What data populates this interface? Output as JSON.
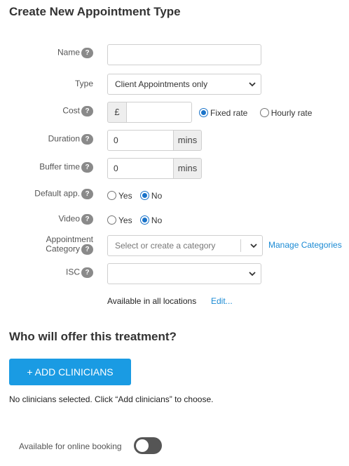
{
  "page_title": "Create New Appointment Type",
  "help_glyph": "?",
  "fields": {
    "name": {
      "label": "Name",
      "value": ""
    },
    "type": {
      "label": "Type",
      "selected": "Client Appointments only"
    },
    "cost": {
      "label": "Cost",
      "currency": "£",
      "value": "",
      "options": [
        "Fixed rate",
        "Hourly rate"
      ],
      "selected": "Fixed rate"
    },
    "duration": {
      "label": "Duration",
      "value": "0",
      "unit": "mins"
    },
    "buffer_time": {
      "label": "Buffer time",
      "value": "0",
      "unit": "mins"
    },
    "default_app": {
      "label": "Default app.",
      "options": [
        "Yes",
        "No"
      ],
      "selected": "No"
    },
    "video": {
      "label": "Video",
      "options": [
        "Yes",
        "No"
      ],
      "selected": "No"
    },
    "appointment_category": {
      "label_line1": "Appointment",
      "label_line2": "Category",
      "placeholder": "Select or create a category",
      "manage_link": "Manage Categories"
    },
    "isc": {
      "label": "ISC",
      "selected": ""
    }
  },
  "locations": {
    "text": "Available in all locations",
    "edit_link": "Edit..."
  },
  "clinicians": {
    "heading": "Who will offer this treatment?",
    "add_button": "+ ADD CLINICIANS",
    "empty_text": "No clinicians selected. Click “Add clinicians” to choose."
  },
  "online_booking": {
    "label": "Available for online booking",
    "enabled": false
  },
  "colors": {
    "accent": "#1a9be3",
    "link": "#1a8ad4",
    "radio": "#1a73c9"
  },
  "icons": [
    "help-icon",
    "chevron-down-icon"
  ]
}
